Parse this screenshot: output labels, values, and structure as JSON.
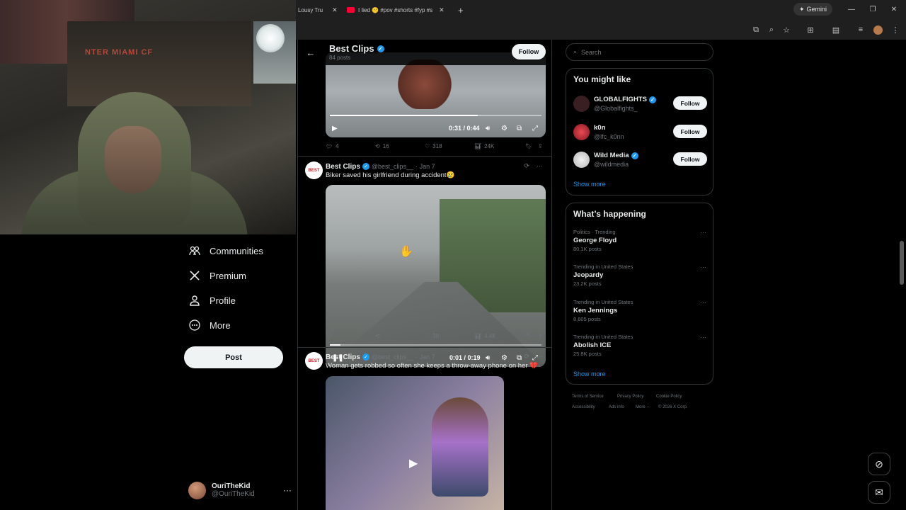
{
  "browser": {
    "tabs": [
      {
        "label": "Lousy Tru"
      },
      {
        "label": "I lied 🤫 #pov #shorts #fyp #s"
      }
    ],
    "gemini_label": "Gemini"
  },
  "sidebar": {
    "items": [
      {
        "label": "Communities",
        "icon": "communities-icon"
      },
      {
        "label": "Premium",
        "icon": "x-logo-icon"
      },
      {
        "label": "Profile",
        "icon": "person-icon"
      },
      {
        "label": "More",
        "icon": "more-circle-icon"
      }
    ],
    "post_label": "Post",
    "account": {
      "name": "OuriTheKid",
      "handle": "@OuriTheKid"
    }
  },
  "profile_header": {
    "name": "Best Clips",
    "post_count": "84 posts",
    "follow_label": "Follow"
  },
  "tweets": [
    {
      "video": {
        "time": "0:31 / 0:44",
        "progress": 0.7
      },
      "stats": {
        "replies": "4",
        "reposts": "16",
        "likes": "318",
        "views": "24K"
      }
    },
    {
      "avatar_text": "BEST",
      "name": "Best Clips",
      "handle": "@best_clips__",
      "date": "· Jan 7",
      "text": "Biker saved his girlfriend during accident😢",
      "video": {
        "time": "0:01 / 0:19",
        "progress": 0.05
      },
      "stats": {
        "replies": "",
        "reposts": "",
        "likes": "38",
        "views": "4.4K"
      }
    },
    {
      "avatar_text": "BEST",
      "name": "Best Clips",
      "handle": "@best_clips__",
      "date": "· Jan 7",
      "text": "Woman gets robbed so often she keeps a throw-away phone on her 💔"
    }
  ],
  "right": {
    "search_placeholder": "Search",
    "you_might_like": {
      "title": "You might like",
      "accounts": [
        {
          "name": "GLOBALFIGHTS",
          "handle": "@Globalfights_",
          "verified": true,
          "follow": "Follow",
          "color": "#3a1f22"
        },
        {
          "name": "k0n",
          "handle": "@lfc_k0nn",
          "verified": false,
          "follow": "Follow",
          "color": "#b82531"
        },
        {
          "name": "Wild Media",
          "handle": "@wildmedia",
          "verified": true,
          "follow": "Follow",
          "color": "#d8d8d8"
        }
      ],
      "show_more": "Show more"
    },
    "whats_happening": {
      "title": "What’s happening",
      "trends": [
        {
          "context": "Politics · Trending",
          "topic": "George Floyd",
          "posts": "80.1K posts"
        },
        {
          "context": "Trending in United States",
          "topic": "Jeopardy",
          "posts": "23.2K posts"
        },
        {
          "context": "Trending in United States",
          "topic": "Ken Jennings",
          "posts": "8,605 posts"
        },
        {
          "context": "Trending in United States",
          "topic": "Abolish ICE",
          "posts": "25.8K posts"
        }
      ],
      "show_more": "Show more"
    },
    "footer": {
      "terms": "Terms of Service",
      "privacy": "Privacy Policy",
      "cookie": "Cookie Policy",
      "accessibility": "Accessibility",
      "ads": "Ads info",
      "more": "More ···",
      "copyright": "© 2026 X Corp."
    }
  },
  "colors": {
    "accent": "#1d9bf0",
    "background": "#000000",
    "border": "#2f3336"
  }
}
